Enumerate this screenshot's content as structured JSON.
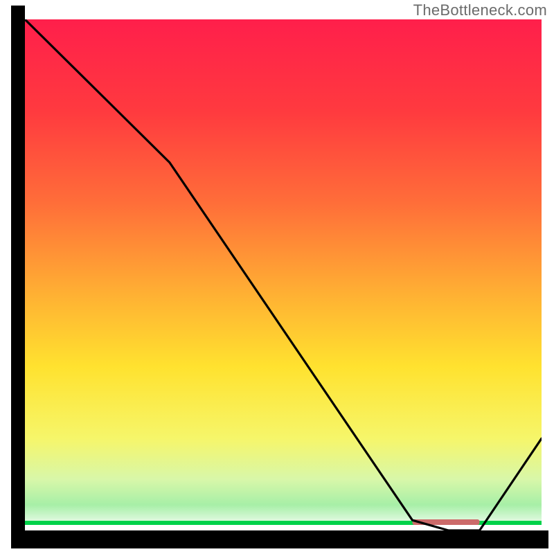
{
  "watermark": "TheBottleneck.com",
  "colors": {
    "frame": "#000000",
    "curve": "#000000",
    "thick_green": "#00d24a",
    "red_segment": "#cc6a6a",
    "gradient_stops": [
      {
        "offset": 0.0,
        "color": "#ff1f4b"
      },
      {
        "offset": 0.18,
        "color": "#ff3a3f"
      },
      {
        "offset": 0.36,
        "color": "#ff6e39"
      },
      {
        "offset": 0.54,
        "color": "#ffb133"
      },
      {
        "offset": 0.68,
        "color": "#ffe22f"
      },
      {
        "offset": 0.82,
        "color": "#f6f66a"
      },
      {
        "offset": 0.9,
        "color": "#d8f7a9"
      },
      {
        "offset": 0.95,
        "color": "#a7efa7"
      },
      {
        "offset": 1.0,
        "color": "#ffffff"
      }
    ]
  },
  "chart_data": {
    "type": "line",
    "title": "",
    "xlabel": "",
    "ylabel": "",
    "xlim": [
      0,
      100
    ],
    "ylim": [
      0,
      100
    ],
    "x": [
      0,
      28,
      75,
      82,
      88,
      100
    ],
    "values": [
      100,
      72,
      2,
      0,
      0,
      18
    ],
    "flat_segment_x": [
      75,
      88
    ],
    "flat_segment_y": 0
  }
}
